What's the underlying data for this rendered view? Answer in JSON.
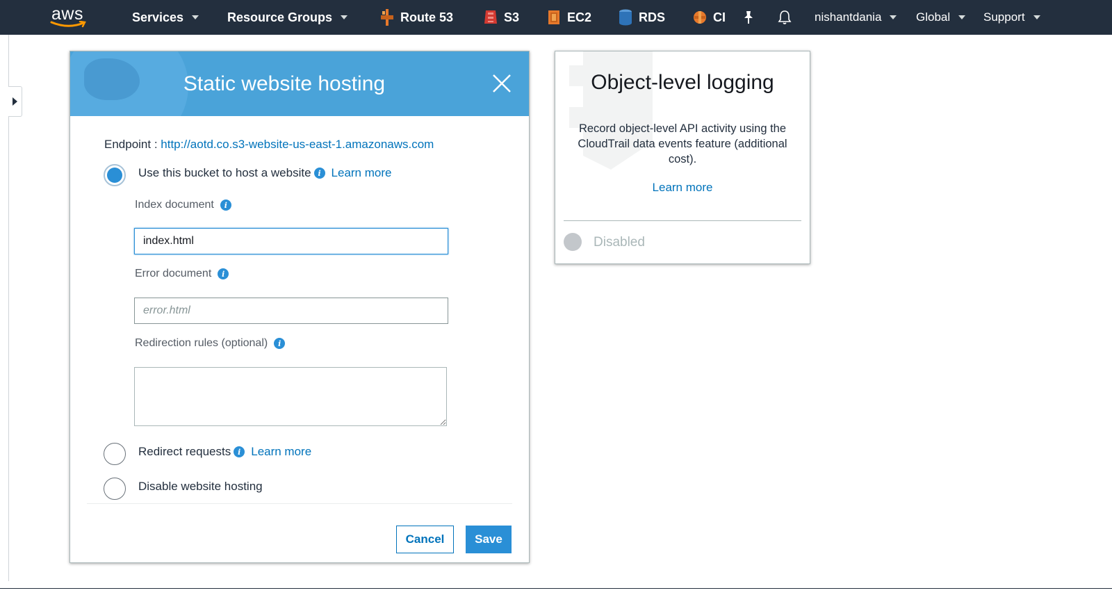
{
  "topnav": {
    "logo": "aws",
    "services": "Services",
    "resource_groups": "Resource Groups",
    "shortcuts": [
      {
        "label": "Route 53",
        "icon": "route53-icon",
        "color": "#e7792b"
      },
      {
        "label": "S3",
        "icon": "s3-icon",
        "color": "#d33a32"
      },
      {
        "label": "EC2",
        "icon": "ec2-icon",
        "color": "#e7792b"
      },
      {
        "label": "RDS",
        "icon": "rds-icon",
        "color": "#2e73b8"
      },
      {
        "label": "CI",
        "icon": "cloudfront-icon",
        "color": "#e7792b"
      }
    ],
    "user": "nishantdania",
    "region": "Global",
    "support": "Support"
  },
  "hosting": {
    "title": "Static website hosting",
    "endpoint_label": "Endpoint : ",
    "endpoint_url": "http://aotd.co.s3-website-us-east-1.amazonaws.com",
    "option_host": "Use this bucket to host a website",
    "learn_more": "Learn more",
    "index_label": "Index document",
    "index_value": "index.html",
    "error_label": "Error document",
    "error_placeholder": "error.html",
    "redirection_label": "Redirection rules (optional)",
    "option_redirect": "Redirect requests",
    "option_disable": "Disable website hosting",
    "cancel": "Cancel",
    "save": "Save",
    "accent": "#2a8fd6",
    "header_color": "#4aa3d9"
  },
  "logging": {
    "title": "Object-level logging",
    "description": "Record object-level API activity using the CloudTrail data events feature (additional cost).",
    "learn_more": "Learn more",
    "status": "Disabled"
  }
}
